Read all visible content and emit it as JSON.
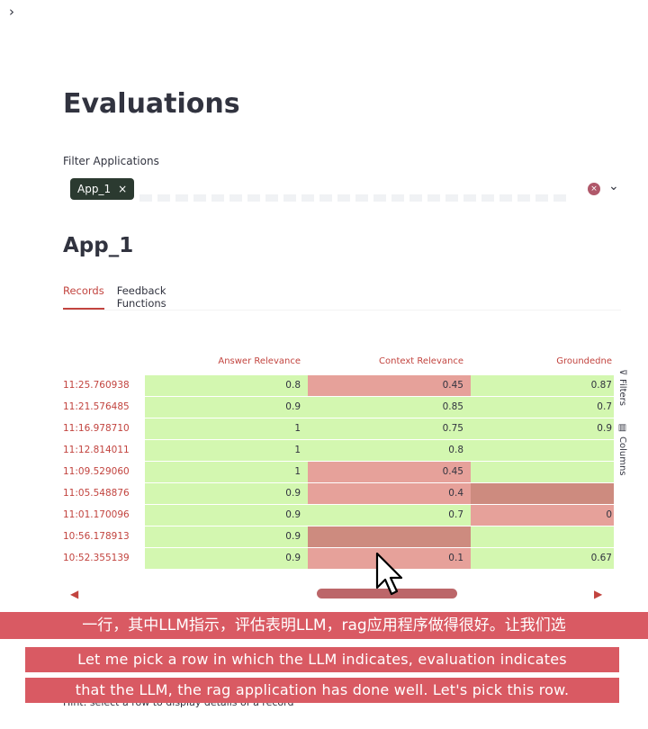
{
  "sidebar_toggle": "›",
  "page_title": "Evaluations",
  "filter": {
    "label": "Filter Applications",
    "chips": [
      "App_1"
    ],
    "chip_remove": "×",
    "clear_icon": "×",
    "dropdown_icon": "⌄"
  },
  "app_title": "App_1",
  "tabs": [
    {
      "label": "Records"
    },
    {
      "label": "Feedback Functions"
    }
  ],
  "table": {
    "columns": [
      "Answer Relevance",
      "Context Relevance",
      "Groundedne"
    ],
    "rows": [
      {
        "ts": "11:25.760938",
        "ar": "0.8",
        "cr": "0.45",
        "gr": "0.87"
      },
      {
        "ts": "11:21.576485",
        "ar": "0.9",
        "cr": "0.85",
        "gr": "0.7"
      },
      {
        "ts": "11:16.978710",
        "ar": "1",
        "cr": "0.75",
        "gr": "0.9"
      },
      {
        "ts": "11:12.814011",
        "ar": "1",
        "cr": "0.8",
        "gr": ""
      },
      {
        "ts": "11:09.529060",
        "ar": "1",
        "cr": "0.45",
        "gr": ""
      },
      {
        "ts": "11:05.548876",
        "ar": "0.9",
        "cr": "0.4",
        "gr": ""
      },
      {
        "ts": "11:01.170096",
        "ar": "0.9",
        "cr": "0.7",
        "gr": "0"
      },
      {
        "ts": "10:56.178913",
        "ar": "0.9",
        "cr": "",
        "gr": ""
      },
      {
        "ts": "10:52.355139",
        "ar": "0.9",
        "cr": "0.1",
        "gr": "0.67"
      }
    ],
    "colors": {
      "good": "#d3f7b0",
      "bad": "#e6a19a",
      "dark_bad": "#cd8b7f"
    },
    "cell_status": [
      [
        "good",
        "bad",
        "good"
      ],
      [
        "good",
        "good",
        "good"
      ],
      [
        "good",
        "good",
        "good"
      ],
      [
        "good",
        "good",
        "good"
      ],
      [
        "good",
        "bad",
        "good"
      ],
      [
        "good",
        "bad",
        "dark_bad"
      ],
      [
        "good",
        "good",
        "bad"
      ],
      [
        "good",
        "dark_bad",
        "good"
      ],
      [
        "good",
        "bad",
        "good"
      ]
    ]
  },
  "side_toolbar": {
    "filters_label": "Filters",
    "filters_icon": "⊽",
    "columns_label": "Columns",
    "columns_icon": "▥"
  },
  "scroll": {
    "left_icon": "◀",
    "right_icon": "▶"
  },
  "hint": "Hint: select a row to display details of a record",
  "subtitles": {
    "zh": "一行，其中LLM指示，评估表明LLM，rag应用程序做得很好。让我们选",
    "en_line1": "Let me pick a row in which the LLM indicates, evaluation indicates",
    "en_line2": "that the LLM, the rag application has done well. Let's pick this row."
  }
}
